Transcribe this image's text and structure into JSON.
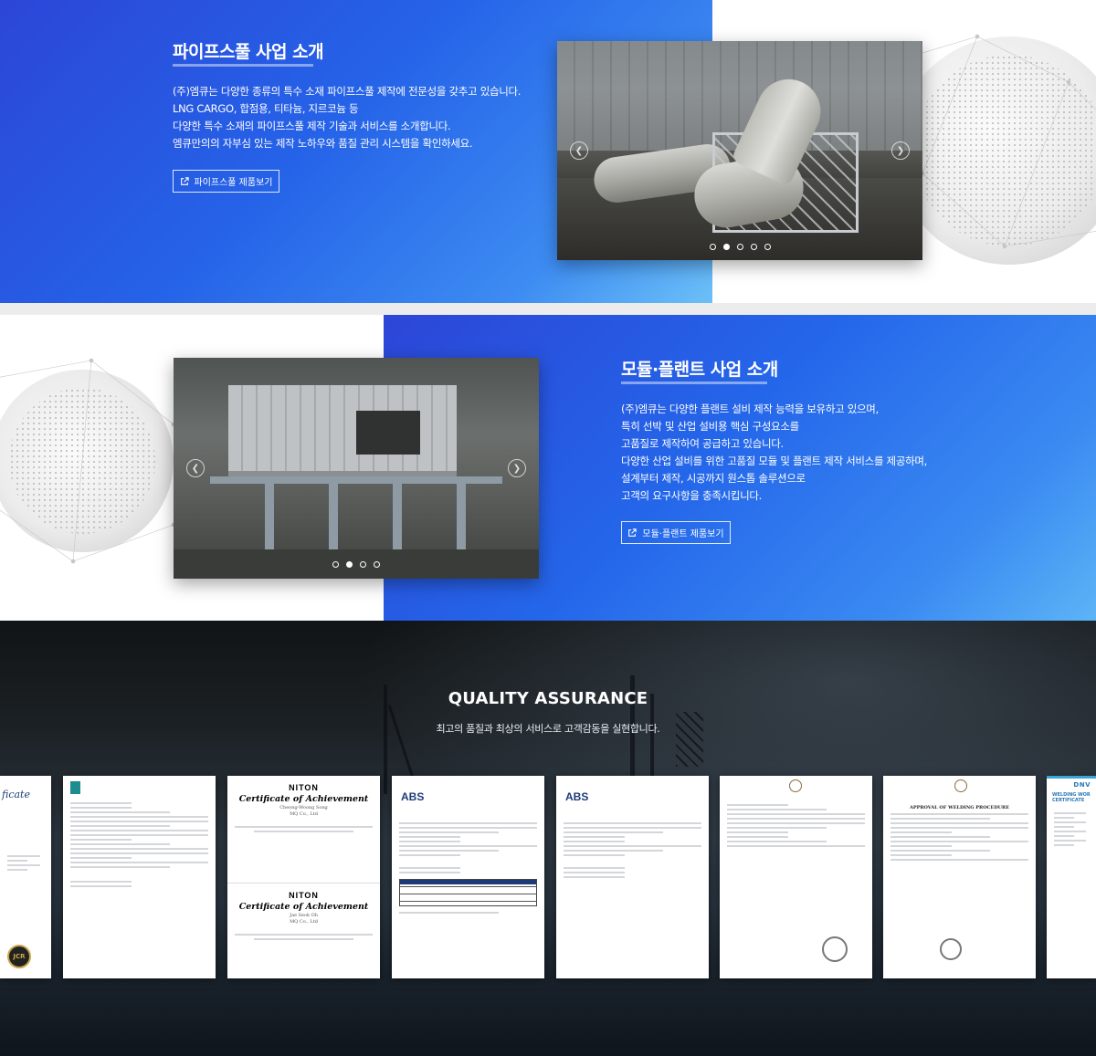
{
  "pipe_section": {
    "title": "파이프스풀 사업 소개",
    "lines": [
      "(주)엠큐는 다양한 종류의 특수 소재 파이프스풀 제작에 전문성을 갖추고 있습니다.",
      "LNG CARGO, 합점용, 티타늄, 지르코늄 등",
      "다양한 특수 소재의 파이프스풀 제작 기술과 서비스를 소개합니다.",
      "엠큐만의의 자부심 있는 제작 노하우와 품질 관리 시스템을 확인하세요."
    ],
    "button_label": "파이프스풀 제품보기",
    "slider_count": 5,
    "slider_active": 1
  },
  "module_section": {
    "title": "모듈·플랜트 사업 소개",
    "lines": [
      "(주)엠큐는 다양한 플랜트 설비 제작 능력을 보유하고 있으며,",
      "특히 선박 및 산업 설비용 핵심 구성요소를",
      "고품질로 제작하여 공급하고 있습니다.",
      "다양한 산업 설비를 위한 고품질 모듈 및 플랜트 제작 서비스를 제공하며,",
      "설계부터 제작, 시공까지 원스톱 솔루션으로",
      "고객의 요구사항을 충족시킵니다."
    ],
    "button_label": "모듈·플랜트 제품보기",
    "slider_count": 4,
    "slider_active": 1
  },
  "quality": {
    "title": "QUALITY ASSURANCE",
    "subtitle": "최고의 품질과 최상의 서비스로 고객감동을 실현합니다.",
    "certs": {
      "partial_title": "ficate",
      "niton_brand": "NITON",
      "niton_title": "Certificate of Achievement",
      "niton_person_1": "Cheong-Woong Song",
      "niton_person_2": "Jae Seok Oh",
      "niton_company": "MQ Co., Ltd",
      "abs_brand": "ABS",
      "dnv_brand": "DNV",
      "dnv_heading": "WELDING WOR CERTIFICATE",
      "welding_heading": "APPROVAL OF WELDING PROCEDURE",
      "jcr_badge": "JCR"
    }
  },
  "icons": [
    "external-link-icon",
    "chevron-left-icon",
    "chevron-right-icon"
  ],
  "colors": {
    "blue_start": "#2c46d8",
    "blue_end": "#6cc0f7",
    "dark_bg": "#1c2125"
  }
}
